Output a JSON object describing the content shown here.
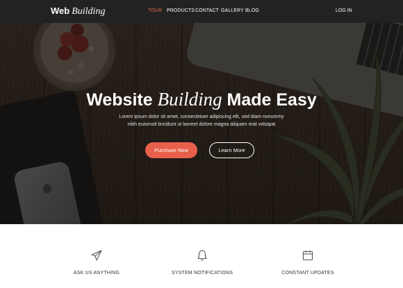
{
  "brand": {
    "word1": "Web",
    "word2": "Building"
  },
  "nav": {
    "items": [
      {
        "label": "TOUR",
        "active": true
      },
      {
        "label": "PRODUCTS",
        "active": false
      },
      {
        "label": "CONTACT",
        "active": false
      },
      {
        "label": "GALLERY",
        "active": false
      },
      {
        "label": "BLOG",
        "active": false
      }
    ],
    "login_label": "LOG IN"
  },
  "hero": {
    "title_part1": "Website",
    "title_italic": "Building",
    "title_part2": "Made Easy",
    "subtitle": "Lorem ipsum dolor sit amet, consectetuer adipiscing elit, sed diam nonummy nibh euismod tincidunt ut laoreet dolore magna aliquam erat volutpat",
    "primary_button": "Purchase Now",
    "secondary_button": "Learn More"
  },
  "features": [
    {
      "icon": "paper-plane-icon",
      "label": "ASK US ANYTHING"
    },
    {
      "icon": "bell-icon",
      "label": "SYSTEM NOTIFICATIONS"
    },
    {
      "icon": "calendar-icon",
      "label": "CONSTANT UPDATES"
    }
  ],
  "colors": {
    "accent": "#e8604c",
    "nav_active": "#e86a4d",
    "navbar_bg": "#222222"
  }
}
